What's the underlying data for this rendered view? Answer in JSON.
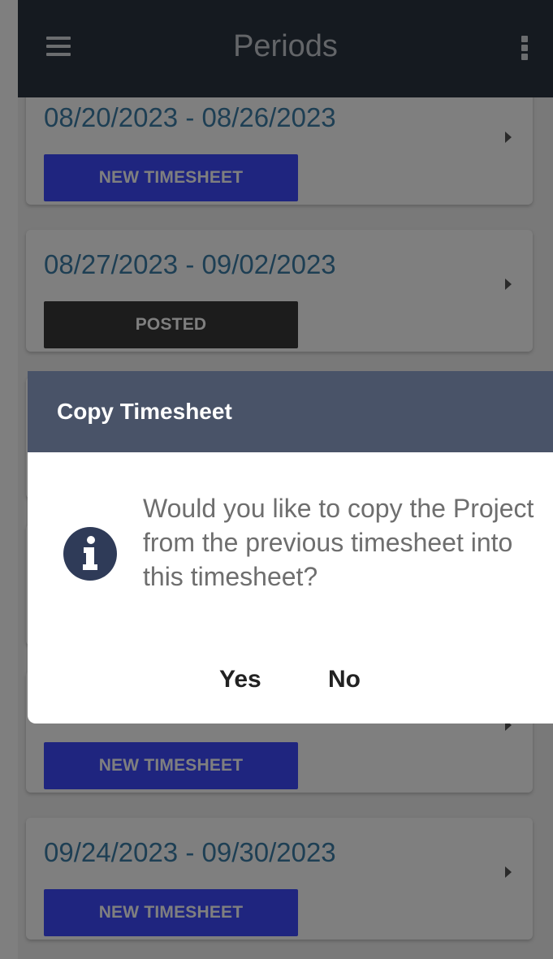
{
  "appbar": {
    "title": "Periods",
    "menu_icon": "hamburger-menu-icon",
    "overflow_icon": "more-vertical-icon"
  },
  "periods": [
    {
      "date_range": "08/20/2023 - 08/26/2023",
      "status": "NEW TIMESHEET",
      "status_color": "#3f4bff"
    },
    {
      "date_range": "08/27/2023 - 09/02/2023",
      "status": "POSTED",
      "status_color": "#383838"
    },
    {
      "date_range": "",
      "status": "NEW TIMESHEET",
      "status_color": "#3f4bff"
    },
    {
      "date_range": "09/24/2023 - 09/30/2023",
      "status": "NEW TIMESHEET",
      "status_color": "#3f4bff"
    }
  ],
  "dialog": {
    "title": "Copy Timesheet",
    "icon": "info-icon",
    "message": "Would you like to copy the Project from the previous timesheet into this timesheet?",
    "yes_label": "Yes",
    "no_label": "No"
  },
  "colors": {
    "appbar_bg": "#2b3441",
    "dialog_header_bg": "#495368",
    "date_text": "#3d7ea8",
    "badge_blue": "#3f4bff",
    "badge_dark": "#383838"
  }
}
